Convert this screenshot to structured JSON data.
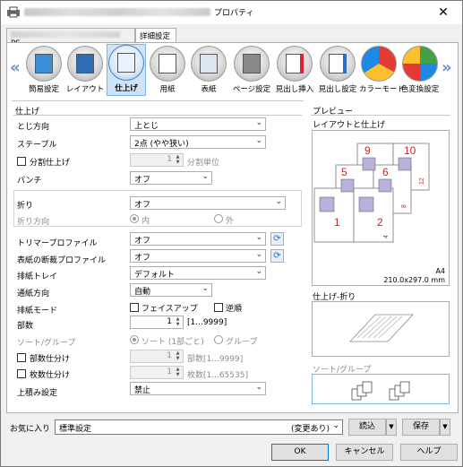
{
  "window": {
    "title_suffix": "プロパティ",
    "close_label": "✕"
  },
  "tabs": {
    "tab1_suffix": "PS",
    "tab2_label": "詳細設定"
  },
  "ribbon": {
    "items": [
      {
        "label": "簡易設定"
      },
      {
        "label": "レイアウト"
      },
      {
        "label": "仕上げ"
      },
      {
        "label": "用紙"
      },
      {
        "label": "表紙"
      },
      {
        "label": "ページ設定"
      },
      {
        "label": "見出し挿入"
      },
      {
        "label": "見出し設定"
      },
      {
        "label": "カラーモード"
      },
      {
        "label": "色変換設定"
      }
    ],
    "selected": "仕上げ"
  },
  "finishing": {
    "section_title": "仕上げ",
    "binding_label": "とじ方向",
    "binding_value": "上とじ",
    "staple_label": "ステープル",
    "staple_value": "2点 (やや狭い)",
    "split_label": "分割仕上げ",
    "split_value": "1",
    "split_unit": "分割単位",
    "punch_label": "パンチ",
    "punch_value": "オフ",
    "fold_label": "折り",
    "fold_value": "オフ",
    "fold_dir_label": "折り方向",
    "fold_dir_in": "内",
    "fold_dir_out": "外",
    "trimmer_label": "トリマープロファイル",
    "trimmer_value": "オフ",
    "cover_trim_label": "表紙の断裁プロファイル",
    "cover_trim_value": "オフ",
    "output_tray_label": "排紙トレイ",
    "output_tray_value": "デフォルト",
    "feed_dir_label": "通紙方向",
    "feed_dir_value": "自動",
    "output_mode_label": "排紙モード",
    "face_up_label": "フェイスアップ",
    "reverse_label": "逆順",
    "copies_label": "部数",
    "copies_value": "1",
    "copies_range": "[1...9999]",
    "sort_group_label": "ソート/グループ",
    "sort_label": "ソート (1部ごと)",
    "group_label": "グループ",
    "copy_split_label": "部数仕分け",
    "copy_split_value": "1",
    "copy_split_range": "部数[1...9999]",
    "sheet_split_label": "枚数仕分け",
    "sheet_split_value": "1",
    "sheet_split_range": "枚数[1...65535]",
    "stack_label": "上積み設定",
    "stack_value": "禁止"
  },
  "preview": {
    "title": "プレビュー",
    "layout_label": "レイアウトと仕上げ",
    "paper_size": "A4",
    "paper_dims": "210.0x297.0 mm",
    "fold_label": "仕上げ-折り",
    "sort_group_label": "ソート/グループ",
    "page_numbers": [
      "1",
      "2",
      "4",
      "5",
      "6",
      "8",
      "9",
      "10",
      "12"
    ]
  },
  "footer": {
    "favorites_label": "お気に入り",
    "favorites_value": "標準設定",
    "favorites_changed": "(変更あり)",
    "load_label": "読込",
    "save_label": "保存",
    "ok_label": "OK",
    "cancel_label": "キャンセル",
    "help_label": "ヘルプ"
  },
  "colors": {
    "accent": "#0078d7",
    "selected_tab_bg": "#cde3f9",
    "page_number_red": "#c0282d"
  }
}
